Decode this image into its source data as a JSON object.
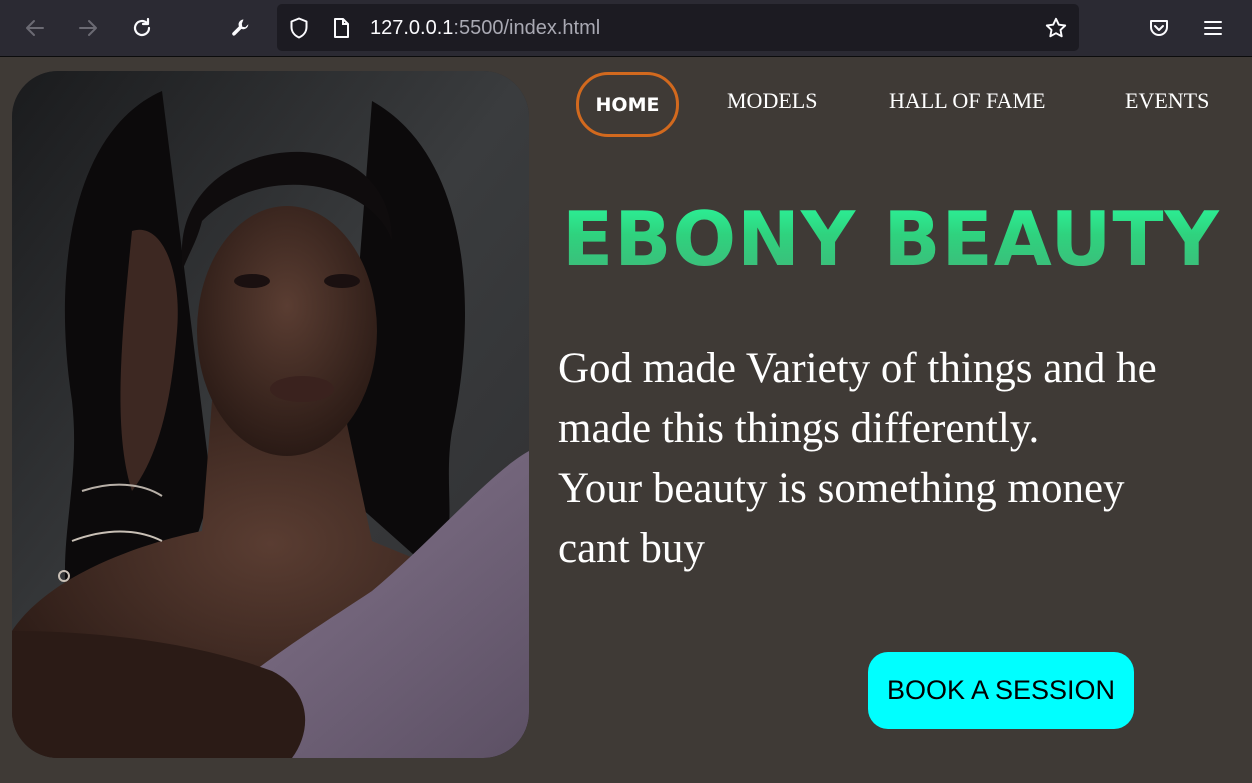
{
  "browser": {
    "url_host": "127.0.0.1",
    "url_path": ":5500/index.html",
    "icons": [
      "back-arrow-icon",
      "forward-arrow-icon",
      "reload-icon",
      "wrench-icon",
      "shield-icon",
      "page-icon",
      "bookmark-star-icon",
      "pocket-icon",
      "hamburger-menu-icon"
    ]
  },
  "nav": {
    "items": [
      {
        "label": "HOME",
        "active": true
      },
      {
        "label": "MODELS"
      },
      {
        "label": "HALL OF FAME"
      },
      {
        "label": "EVENTS"
      }
    ],
    "active_border_color": "#d2691e"
  },
  "hero": {
    "title": "EBONY BEAUTY",
    "tagline_lines": [
      "God made Variety of things and he",
      "made this things differently.",
      "Your beauty is something money",
      "cant buy"
    ],
    "cta_label": "BOOK A SESSION",
    "title_color": "#2ee08a",
    "cta_color": "#00ffff",
    "background_color": "#3f3a36"
  }
}
